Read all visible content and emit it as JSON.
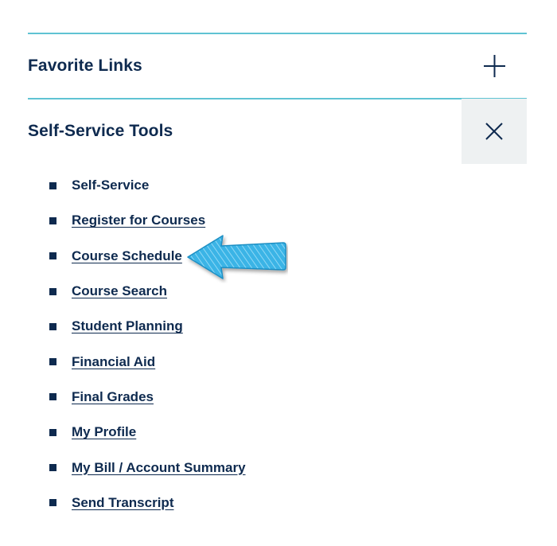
{
  "favorite_links": {
    "title": "Favorite Links",
    "toggle_icon": "plus-icon"
  },
  "self_service_tools": {
    "title": "Self-Service Tools",
    "toggle_icon": "close-icon",
    "links": [
      {
        "label": "Self-Service"
      },
      {
        "label": "Register for Courses"
      },
      {
        "label": "Course Schedule"
      },
      {
        "label": "Course Search"
      },
      {
        "label": "Student Planning"
      },
      {
        "label": "Financial Aid"
      },
      {
        "label": "Final Grades"
      },
      {
        "label": "My Profile"
      },
      {
        "label": "My Bill / Account Summary"
      },
      {
        "label": "Send Transcript"
      }
    ]
  },
  "colors": {
    "text": "#0e2a4f",
    "divider": "#5fc3d3",
    "toggle_open_bg": "#eef1f2",
    "annotation_arrow": "#3bb4e6"
  },
  "annotation": {
    "icon": "pointer-arrow-icon",
    "points_to": "Course Schedule"
  }
}
